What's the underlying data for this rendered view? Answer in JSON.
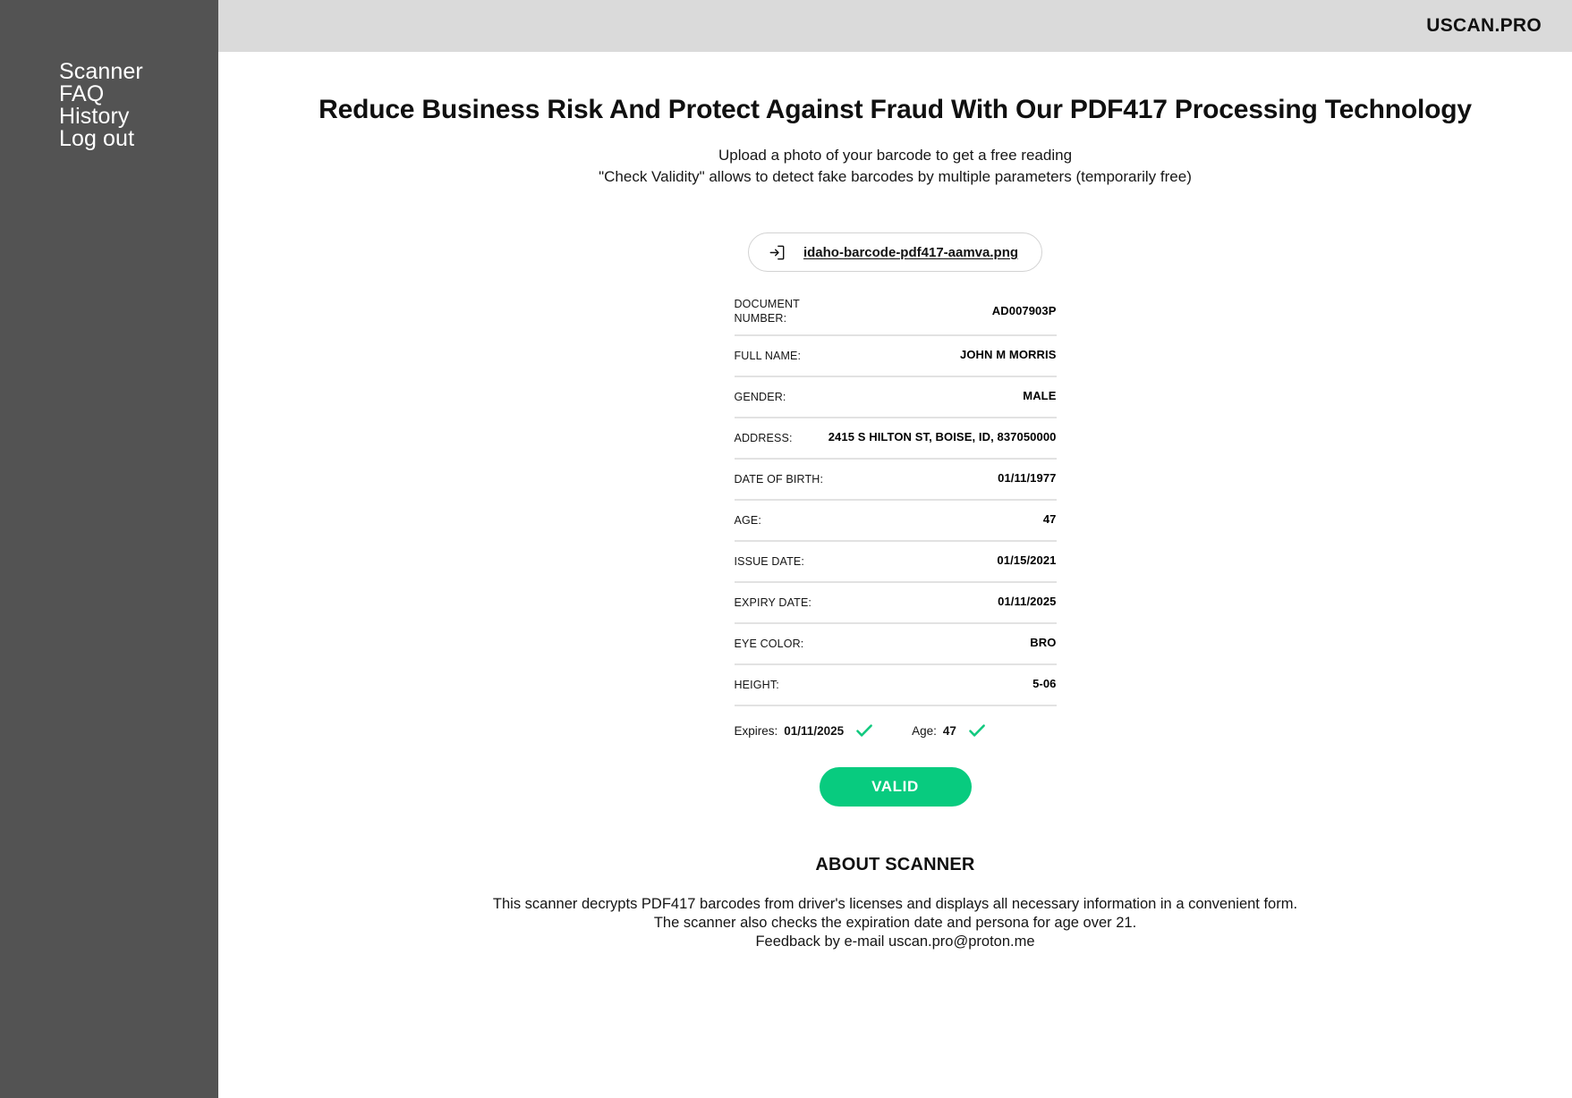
{
  "header": {
    "brand": "USCAN.PRO",
    "background_color": "#dadada"
  },
  "sidebar": {
    "background_color": "#535353",
    "items": [
      {
        "label": "Scanner",
        "name": "sidebar-item-scanner"
      },
      {
        "label": "FAQ",
        "name": "sidebar-item-faq"
      },
      {
        "label": "History",
        "name": "sidebar-item-history"
      },
      {
        "label": "Log out",
        "name": "sidebar-item-logout"
      }
    ]
  },
  "main": {
    "title": "Reduce Business Risk And Protect Against Fraud With Our PDF417 Processing Technology",
    "subtitle_line1": "Upload a photo of your barcode to get a free reading",
    "subtitle_line2": "\"Check Validity\" allows to detect fake barcodes by multiple parameters (temporarily free)",
    "upload": {
      "icon": "import-arrow-icon",
      "filename": "idaho-barcode-pdf417-aamva.png"
    },
    "result_rows": [
      {
        "label": "DOCUMENT NUMBER:",
        "value": "AD007903P"
      },
      {
        "label": "FULL NAME:",
        "value": "JOHN M MORRIS"
      },
      {
        "label": "GENDER:",
        "value": "MALE"
      },
      {
        "label": "ADDRESS:",
        "value": "2415 S HILTON ST, BOISE, ID, 837050000"
      },
      {
        "label": "DATE OF BIRTH:",
        "value": "01/11/1977"
      },
      {
        "label": "AGE:",
        "value": "47"
      },
      {
        "label": "ISSUE DATE:",
        "value": "01/15/2021"
      },
      {
        "label": "EXPIRY DATE:",
        "value": "01/11/2025"
      },
      {
        "label": "EYE COLOR:",
        "value": "BRO"
      },
      {
        "label": "HEIGHT:",
        "value": "5-06"
      }
    ],
    "checks": [
      {
        "label": "Expires:",
        "value": "01/11/2025",
        "status": "pass",
        "icon": "check-icon"
      },
      {
        "label": "Age:",
        "value": "47",
        "status": "pass",
        "icon": "check-icon"
      }
    ],
    "valid_button": {
      "label": "VALID",
      "color": "#08cb7f"
    },
    "about": {
      "title": "ABOUT SCANNER",
      "line1": "This scanner decrypts PDF417 barcodes from driver's licenses and displays all necessary information in a convenient form.",
      "line2": "The scanner also checks the expiration date and persona for age over 21.",
      "line3": "Feedback by e-mail uscan.pro@proton.me"
    }
  },
  "colors": {
    "accent_green": "#08cb7f",
    "sidebar": "#535353",
    "topbar": "#dadada",
    "divider": "#e2e2e2"
  }
}
